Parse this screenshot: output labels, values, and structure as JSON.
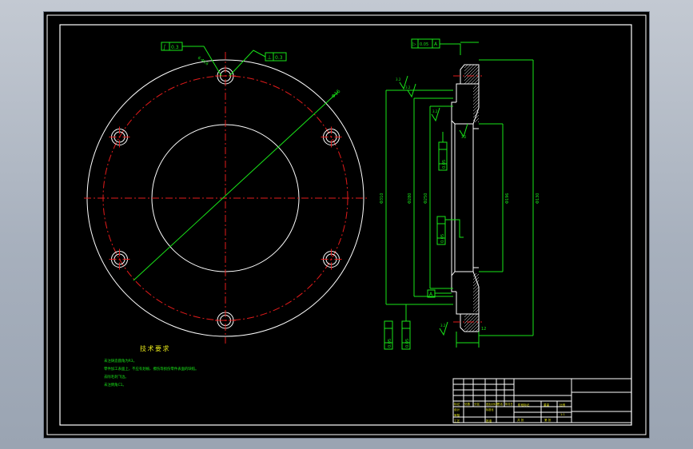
{
  "drawing": {
    "tech_requirements": {
      "title": "技术要求",
      "lines": [
        "未注铸造圆角为R3。",
        "零件加工表面上，不应有划痕、擦伤等损伤零件表面的缺陷。",
        "去除毛刺飞边。",
        "未注倒角C1。"
      ]
    },
    "front_view": {
      "bolt_hole_count": 6,
      "diameter_label": "Φ16",
      "tolerance_frame_1": [
        "∫",
        "0.3"
      ],
      "tolerance_frame_2": [
        "⊥",
        "0.3"
      ],
      "hole_note": "6-Φ16"
    },
    "section_view": {
      "top_frame": [
        "▷",
        "0.05",
        "A"
      ],
      "datum_A": "A",
      "dims": {
        "outer": "Φ310",
        "pitch": "Φ280",
        "bore": "Φ250",
        "face": "Φ196",
        "inner": "Φ130",
        "bottom_small": "12"
      },
      "left_frame_1": [
        "▷",
        "0.05",
        "A"
      ],
      "left_frame_2": [
        "▷",
        "0.05",
        "A"
      ],
      "inner_frame_1": [
        "▷",
        "0.05",
        "A"
      ],
      "inner_frame_2": [
        "▷",
        "0.05",
        "A"
      ],
      "roughness": [
        "3.2",
        "3.2",
        "3.2",
        "3.2",
        "3.2"
      ]
    },
    "title_block": {
      "row_labels": [
        "标记",
        "处数",
        "分区",
        "更改文件号",
        "签名",
        "年月日"
      ],
      "design": "设计",
      "standard": "标准化",
      "review": "审核",
      "process": "工艺",
      "approve": "批准",
      "stage": "阶段标记",
      "weight": "重量",
      "scale": "比例",
      "scale_value": "1:1",
      "sheet_total": "共  张",
      "sheet_num": "第  张"
    }
  }
}
